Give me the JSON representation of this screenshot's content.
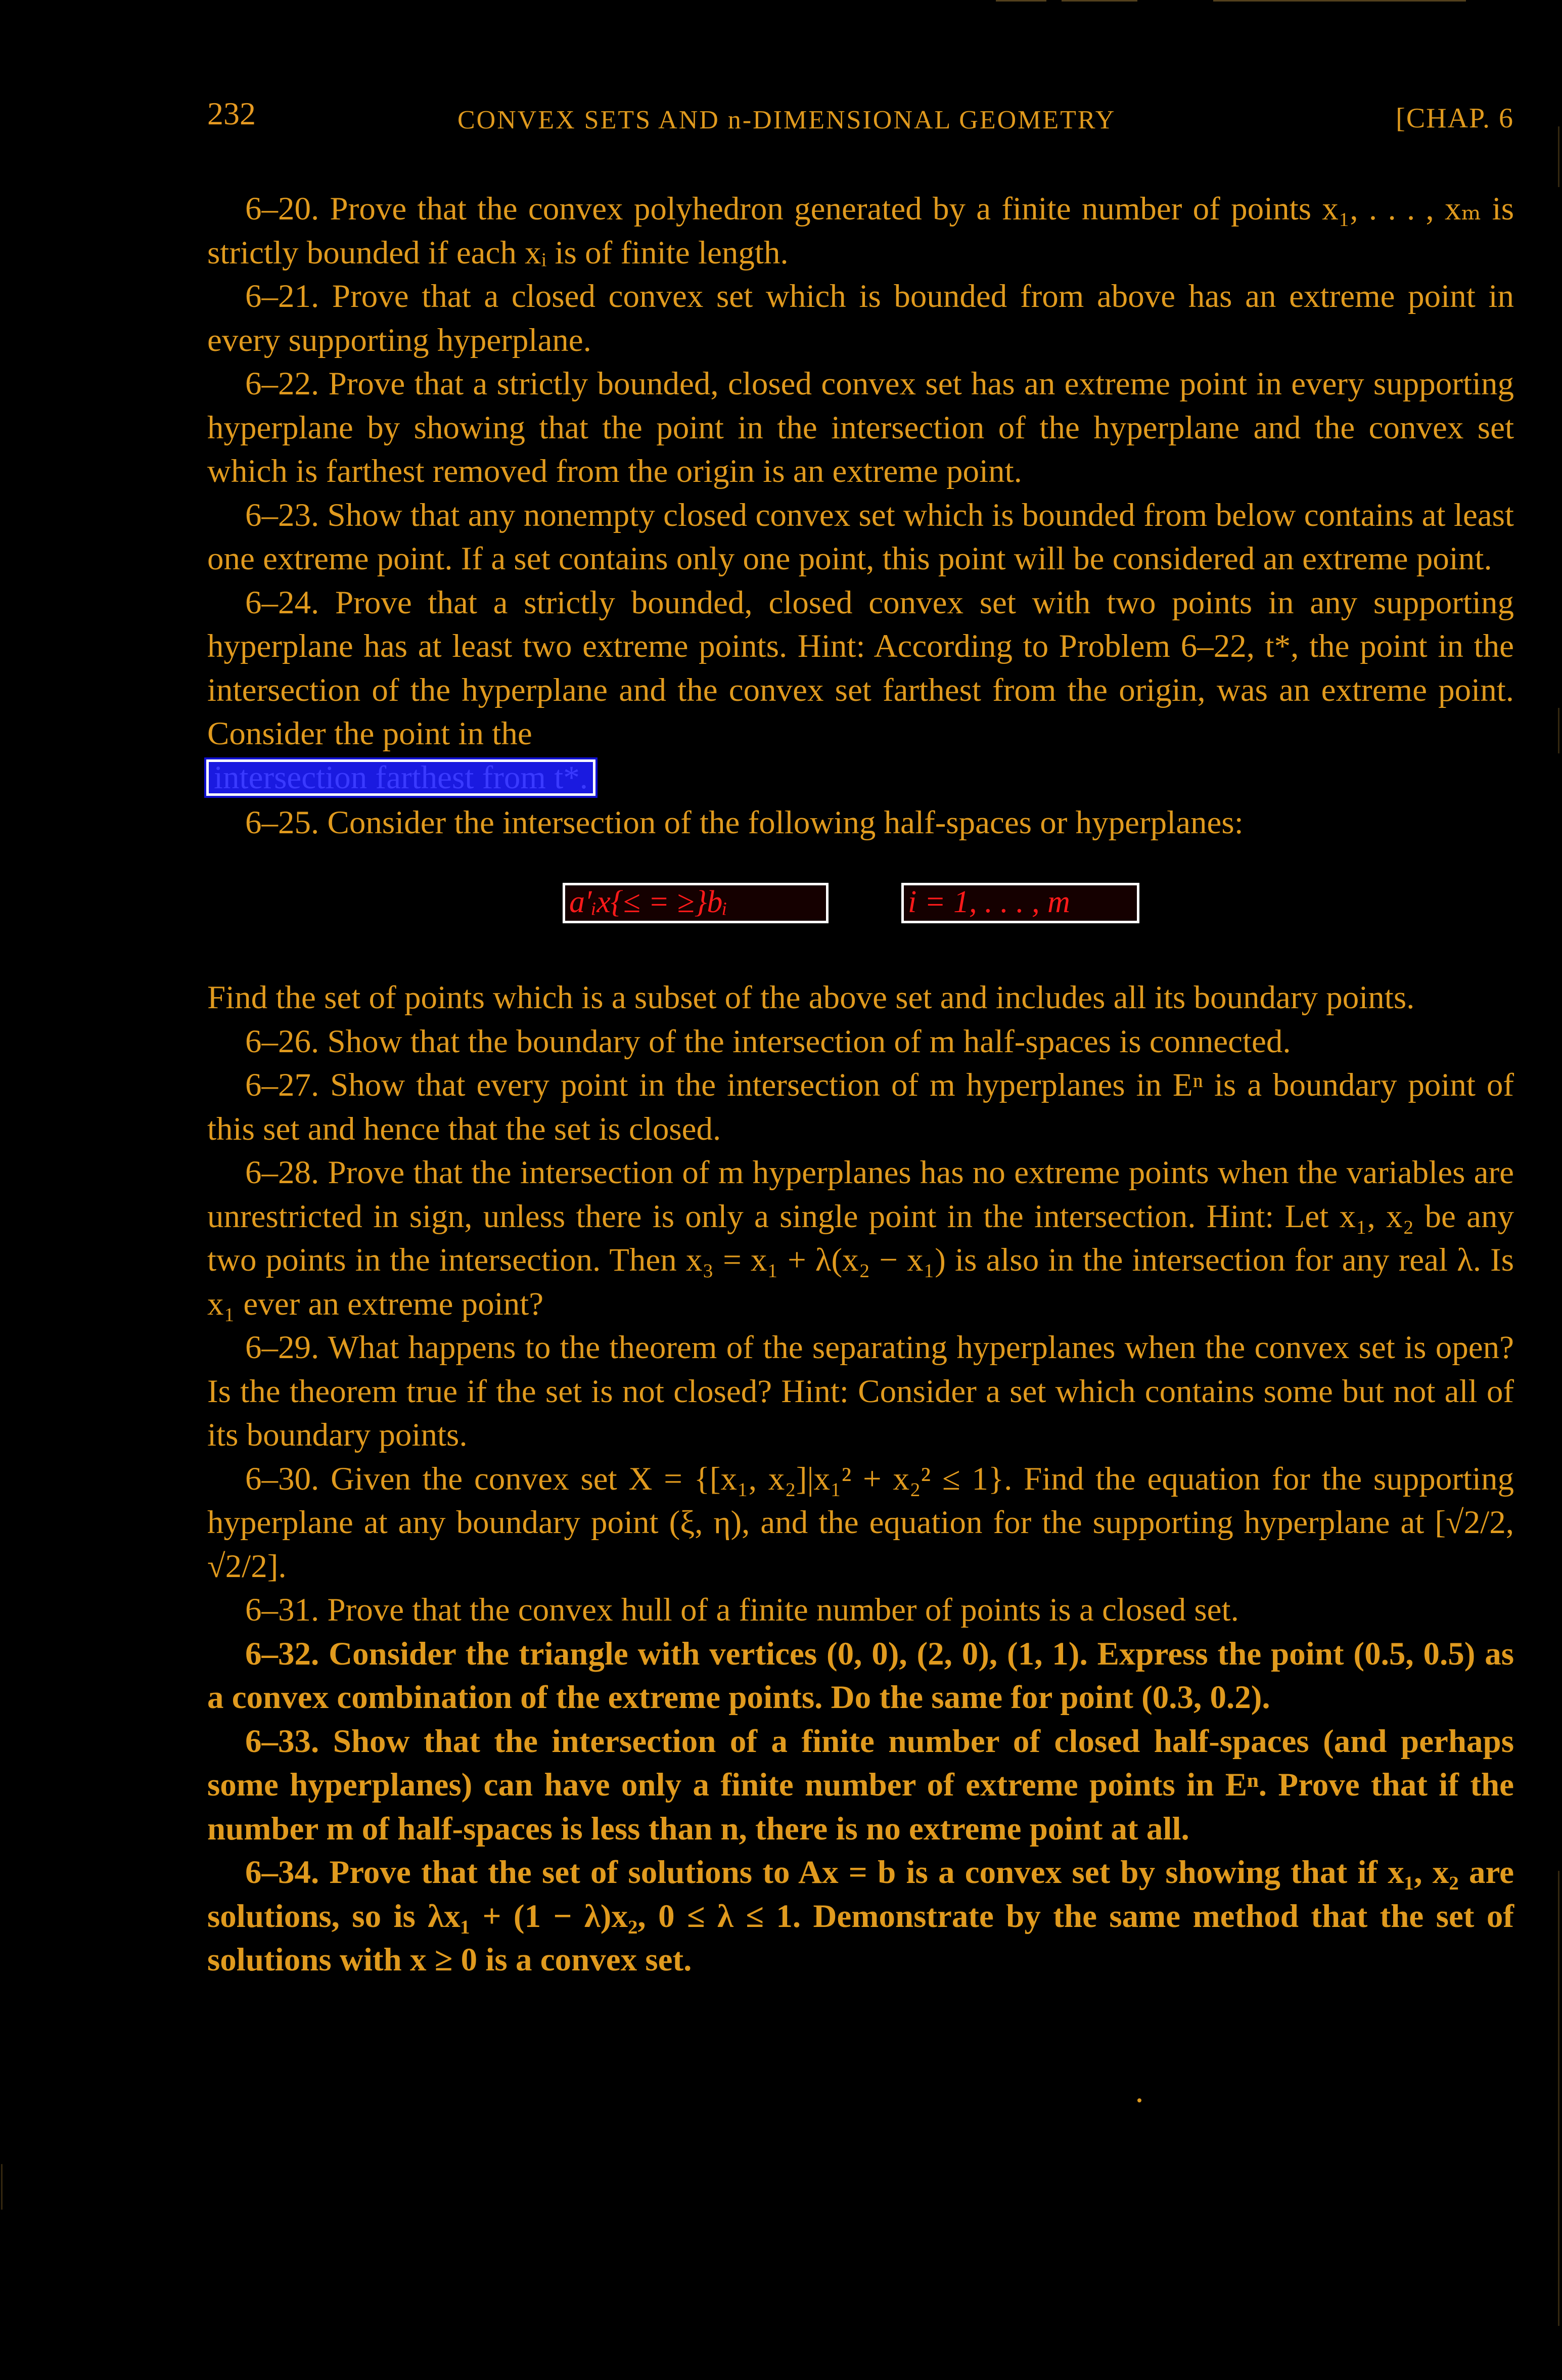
{
  "header": {
    "page_number": "232",
    "running_title": "CONVEX SETS AND n-DIMENSIONAL GEOMETRY",
    "chapter": "[CHAP. 6"
  },
  "problems": {
    "p20": "6–20. Prove that the convex polyhedron generated by a finite number of points x₁, . . . , xₘ is strictly bounded if each xᵢ is of finite length.",
    "p21": "6–21. Prove that a closed convex set which is bounded from above has an extreme point in every supporting hyperplane.",
    "p22": "6–22. Prove that a strictly bounded, closed convex set has an extreme point in every supporting hyperplane by showing that the point in the intersection of the hyperplane and the convex set which is farthest removed from the origin is an extreme point.",
    "p23": "6–23. Show that any nonempty closed convex set which is bounded from below contains at least one extreme point. If a set contains only one point, this point will be considered an extreme point.",
    "p24": "6–24. Prove that a strictly bounded, closed convex set with two points in any supporting hyperplane has at least two extreme points. Hint: According to Problem 6–22, t*, the point in the intersection of the hyperplane and the convex set farthest from the origin, was an extreme point. Consider the point in the",
    "p24_highlight": "intersection farthest from t*.",
    "p25": "6–25. Consider the intersection of the following half-spaces or hyperplanes:",
    "formula_left": "a′ᵢx{≤ = ≥}bᵢ",
    "formula_right": "i = 1, . . . , m",
    "p25_cont": "Find the set of points which is a subset of the above set and includes all its boundary points.",
    "p26": "6–26. Show that the boundary of the intersection of m half-spaces is connected.",
    "p27": "6–27. Show that every point in the intersection of m hyperplanes in Eⁿ is a boundary point of this set and hence that the set is closed.",
    "p28": "6–28. Prove that the intersection of m hyperplanes has no extreme points when the variables are unrestricted in sign, unless there is only a single point in the intersection. Hint: Let x₁, x₂ be any two points in the intersection. Then x₃ = x₁ + λ(x₂ − x₁) is also in the intersection for any real λ. Is x₁ ever an extreme point?",
    "p29": "6–29. What happens to the theorem of the separating hyperplanes when the convex set is open? Is the theorem true if the set is not closed? Hint: Consider a set which contains some but not all of its boundary points.",
    "p30": "6–30. Given the convex set X = {[x₁, x₂]|x₁² + x₂² ≤ 1}. Find the equation for the supporting hyperplane at any boundary point (ξ, η), and the equation for the supporting hyperplane at [√2/2, √2/2].",
    "p31": "6–31. Prove that the convex hull of a finite number of points is a closed set.",
    "p32": "6–32. Consider the triangle with vertices (0, 0), (2, 0), (1, 1). Express the point (0.5, 0.5) as a convex combination of the extreme points. Do the same for point (0.3, 0.2).",
    "p33": "6–33. Show that the intersection of a finite number of closed half-spaces (and perhaps some hyperplanes) can have only a finite number of extreme points in Eⁿ. Prove that if the number m of half-spaces is less than n, there is no extreme point at all.",
    "p34": "6–34. Prove that the set of solutions to Ax = b is a convex set by showing that if x₁, x₂ are solutions, so is λx₁ + (1 − λ)x₂, 0 ≤ λ ≤ 1. Demonstrate by the same method that the set of solutions with x ≥ 0 is a convex set."
  },
  "colors": {
    "background": "#000000",
    "text": "#e09a1e",
    "highlight_fill": "#1a1ae0",
    "highlight_text": "#3a3aff",
    "formula_text": "#ff1a1a",
    "box_border": "#ffffff"
  }
}
